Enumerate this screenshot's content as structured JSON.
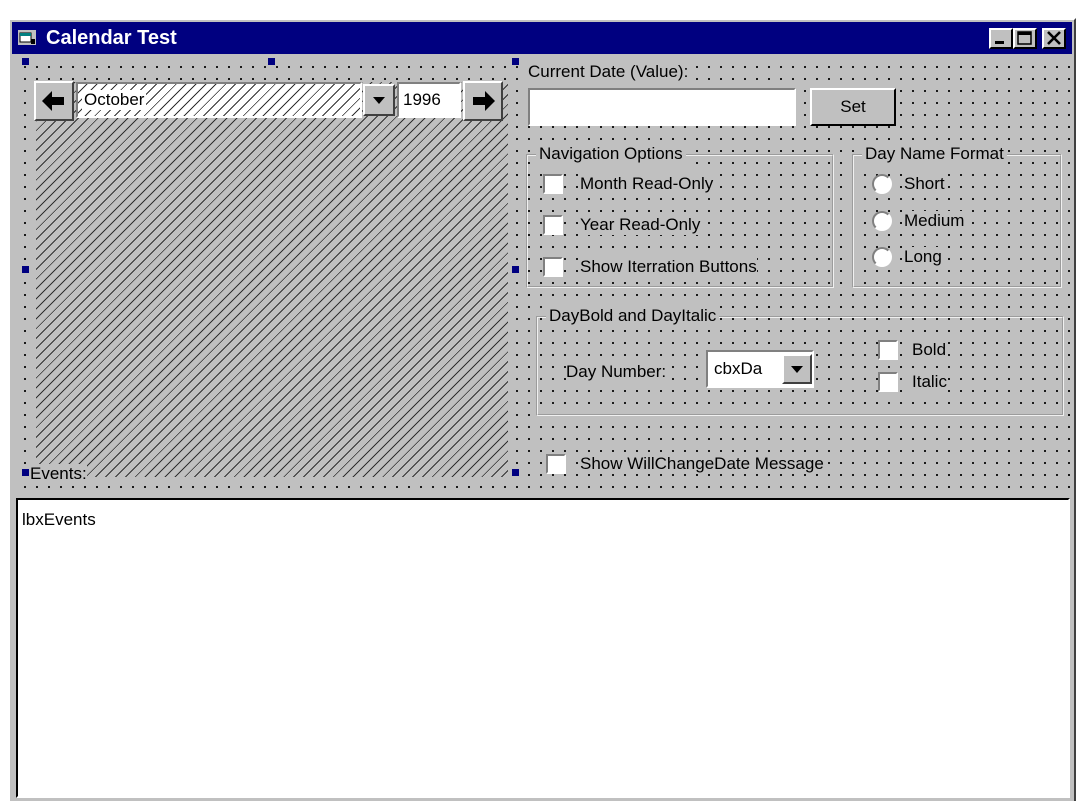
{
  "window": {
    "title": "Calendar Test",
    "minimize_icon": "minimize-icon",
    "maximize_icon": "maximize-icon",
    "close_icon": "close-icon"
  },
  "calendar": {
    "month": "October",
    "year": "1996",
    "prev_icon": "arrow-left-icon",
    "next_icon": "arrow-right-icon",
    "dropdown_icon": "chevron-down-icon"
  },
  "current_date": {
    "label": "Current Date (Value):",
    "value": "",
    "set_label": "Set"
  },
  "navigation_options": {
    "caption": "Navigation Options",
    "items": [
      {
        "label": "Month Read-Only",
        "checked": false
      },
      {
        "label": "Year Read-Only",
        "checked": false
      },
      {
        "label": "Show Iterration Buttons",
        "checked": false
      }
    ]
  },
  "day_name_format": {
    "caption": "Day Name Format",
    "items": [
      {
        "label": "Short",
        "selected": false
      },
      {
        "label": "Medium",
        "selected": false
      },
      {
        "label": "Long",
        "selected": false
      }
    ]
  },
  "day_bold_italic": {
    "caption": "DayBold and DayItalic",
    "day_number_label": "Day Number:",
    "combo_value": "cbxDa",
    "bold_label": "Bold",
    "italic_label": "Italic"
  },
  "will_change": {
    "label": "Show WillChangeDate Message",
    "checked": false
  },
  "events": {
    "label": "Events:",
    "listbox_text": "lbxEvents"
  },
  "colors": {
    "titlebar": "#000080",
    "face": "#c0c0c0",
    "handle": "#000080"
  }
}
